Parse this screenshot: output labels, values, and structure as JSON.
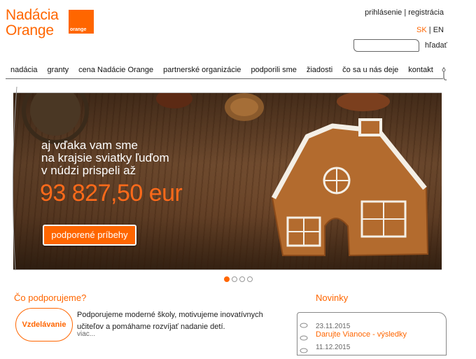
{
  "brand": {
    "line1": "Nadácia",
    "line2": "Orange",
    "logo_word": "orange"
  },
  "header": {
    "login": "prihlásenie",
    "separator": "|",
    "register": "registrácia",
    "lang_sk": "SK",
    "lang_en": "EN",
    "search_placeholder": "",
    "search_button": "hľadať"
  },
  "nav": {
    "items": [
      "nadácia",
      "granty",
      "cena Nadácie Orange",
      "partnerské organizácie",
      "podporili sme",
      "žiadosti",
      "čo sa u nás deje",
      "kontakt"
    ]
  },
  "banner": {
    "line1": "aj vďaka vam sme",
    "line2": "na krajsie sviatky ľuďom",
    "line3": "v núdzi prispeli až",
    "amount": "93 827,50 eur",
    "button": "podporené príbehy",
    "slides_total": 4,
    "slide_active": 1
  },
  "support": {
    "title": "Čo podporujeme?",
    "bubble": "Vzdelávanie",
    "description": "Podporujeme moderné školy, motivujeme inovatívnych učiteľov a pomáhame rozvíjať nadanie detí.",
    "more": "viac..."
  },
  "news": {
    "title": "Novinky",
    "items": [
      {
        "date": "23.11.2015",
        "title": "Darujte Vianoce - výsledky"
      },
      {
        "date": "11.12.2015",
        "title": ""
      }
    ]
  },
  "colors": {
    "accent": "#ff6600"
  }
}
